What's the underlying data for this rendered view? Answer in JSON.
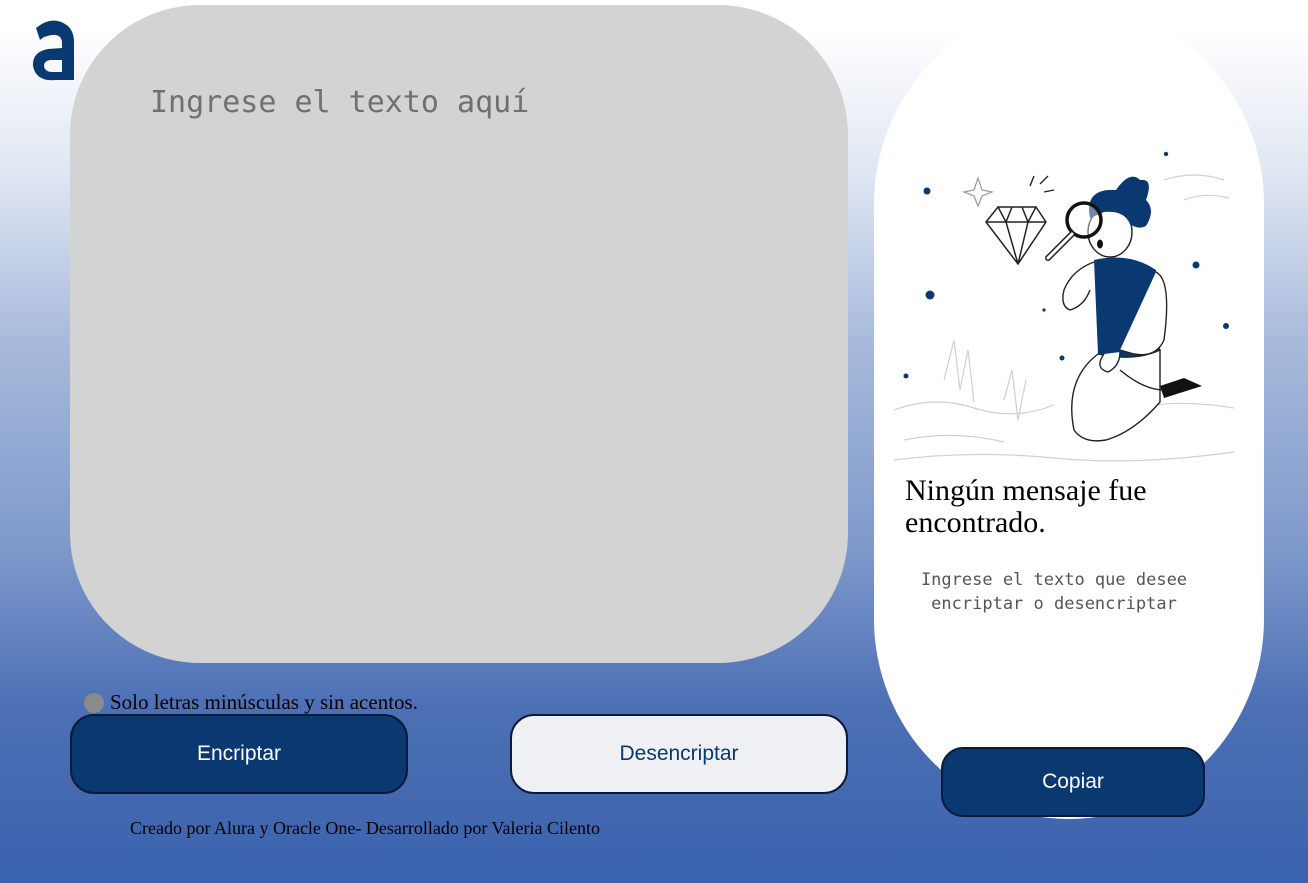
{
  "logo": {
    "icon": "alura-logo-icon",
    "color": "#0a3871"
  },
  "input": {
    "placeholder": "Ingrese el texto aquí",
    "value": ""
  },
  "hint": {
    "icon": "info-icon",
    "text": "Solo letras minúsculas y sin acentos."
  },
  "buttons": {
    "encrypt": "Encriptar",
    "decrypt": "Desencriptar",
    "copy": "Copiar"
  },
  "output": {
    "illustration": "person-with-magnifier-illustration",
    "title": "Ningún mensaje fue encontrado.",
    "subtitle": "Ingrese el texto que desee encriptar o desencriptar"
  },
  "footer": {
    "text": "Creado por Alura y Oracle One- Desarrollado por Valeria Cilento"
  },
  "colors": {
    "primary": "#0a3871",
    "input_bg": "#d3d3d3",
    "secondary_btn_bg": "#eff0f3"
  }
}
